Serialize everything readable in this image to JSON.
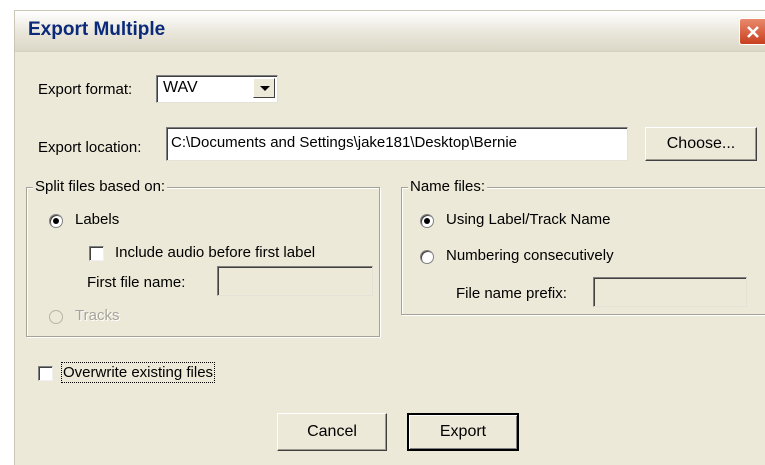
{
  "window": {
    "title": "Export Multiple"
  },
  "export_format": {
    "label": "Export format:",
    "value": "WAV"
  },
  "export_location": {
    "label": "Export location:",
    "value": "C:\\Documents and Settings\\jake181\\Desktop\\Bernie",
    "choose_label": "Choose..."
  },
  "split_group": {
    "legend": "Split files based on:",
    "labels_option": "Labels",
    "include_audio": "Include audio before first label",
    "first_file_name_label": "First file name:",
    "first_file_name_value": "",
    "tracks_option": "Tracks"
  },
  "name_group": {
    "legend": "Name files:",
    "using_label": "Using Label/Track Name",
    "numbering": "Numbering consecutively",
    "prefix_label": "File name prefix:",
    "prefix_value": ""
  },
  "overwrite": {
    "label": "Overwrite existing files"
  },
  "buttons": {
    "cancel": "Cancel",
    "export": "Export"
  }
}
